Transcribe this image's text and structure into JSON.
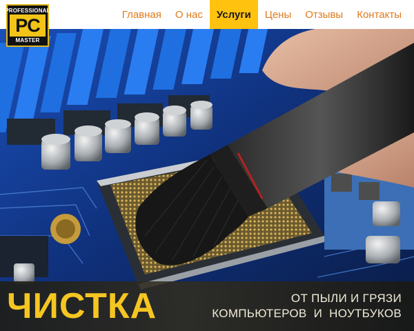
{
  "logo": {
    "top_text": "PROFESSIONAL",
    "main_text": "PC",
    "bottom_text": "MASTER"
  },
  "nav": {
    "items": [
      {
        "label": "Главная"
      },
      {
        "label": "О нас"
      },
      {
        "label": "Услуги"
      },
      {
        "label": "Цены"
      },
      {
        "label": "Отзывы"
      },
      {
        "label": "Контакты"
      }
    ],
    "active": "Услуги"
  },
  "banner": {
    "title": "ЧИСТКА",
    "subtitle_line1": "ОТ ПЫЛИ И ГРЯЗИ",
    "subtitle_line2": "КОМПЬЮТЕРОВ  И  НОУТБУКОВ"
  },
  "colors": {
    "nav_text": "#e07a1a",
    "nav_active_bg": "#ffc20e",
    "brand_yellow": "#f5c622",
    "logo_bg": "#111111"
  }
}
